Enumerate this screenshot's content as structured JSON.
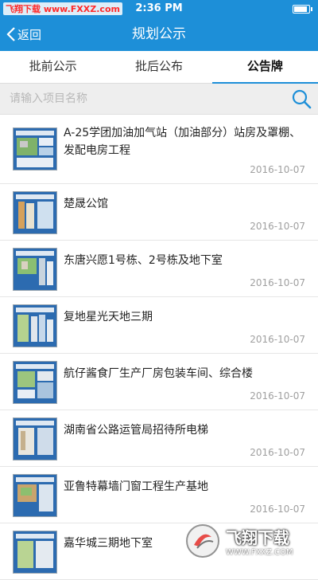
{
  "status_bar": {
    "watermark": "飞翔下载 www.FXXZ.com",
    "time": "2:36 PM"
  },
  "nav": {
    "back_label": "返回",
    "title": "规划公示"
  },
  "tabs": [
    {
      "label": "批前公示",
      "active": false
    },
    {
      "label": "批后公布",
      "active": false
    },
    {
      "label": "公告牌",
      "active": true
    }
  ],
  "search": {
    "placeholder": "请输入项目名称",
    "value": ""
  },
  "items": [
    {
      "title": "A-25学团加油加气站（加油部分）站房及罩棚、发配电房工程",
      "date": "2016-10-07"
    },
    {
      "title": "楚晟公馆",
      "date": "2016-10-07"
    },
    {
      "title": "东唐兴愿1号栋、2号栋及地下室",
      "date": "2016-10-07"
    },
    {
      "title": "复地星光天地三期",
      "date": "2016-10-07"
    },
    {
      "title": "航仔酱食厂生产厂房包装车间、综合楼",
      "date": "2016-10-07"
    },
    {
      "title": "湖南省公路运管局招待所电梯",
      "date": "2016-10-07"
    },
    {
      "title": "亚鲁特幕墙门窗工程生产基地",
      "date": "2016-10-07"
    },
    {
      "title": "嘉华城三期地下室",
      "date": ""
    }
  ],
  "corner_watermark": {
    "text": "飞翔下载",
    "url": "WWW.FXXZ.COM"
  },
  "colors": {
    "primary": "#1d8fd8",
    "date": "#a0a0a0"
  }
}
